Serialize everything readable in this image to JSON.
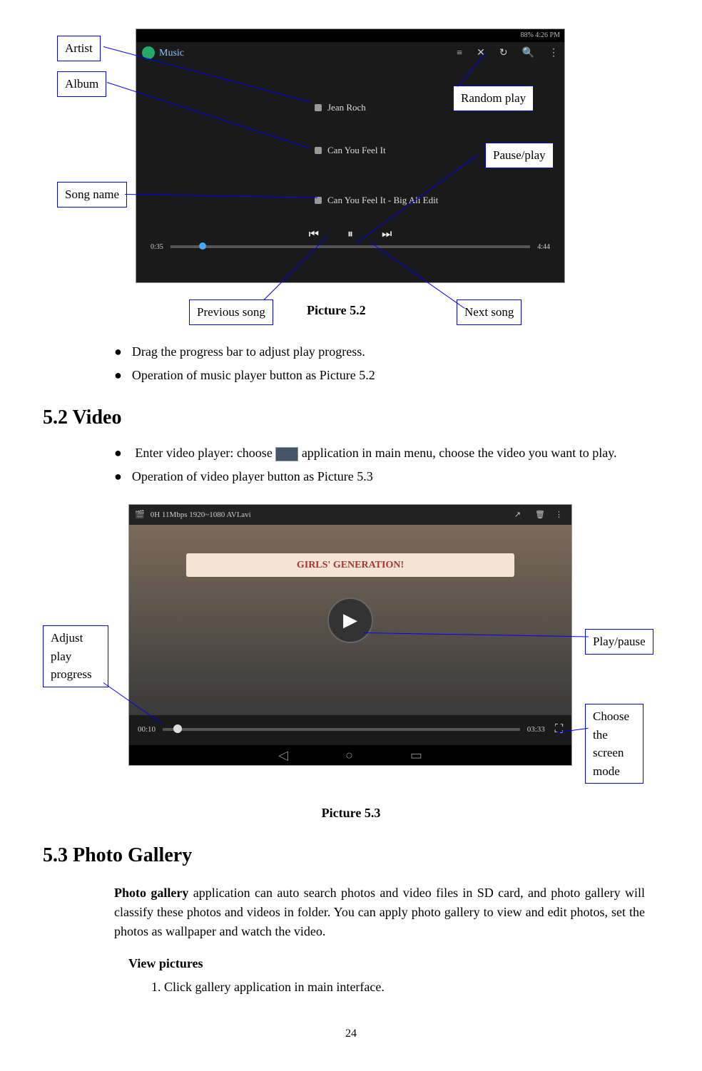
{
  "page_number": "24",
  "figure1": {
    "status": "88% 4:26 PM",
    "app_title": "Music",
    "artist": "Jean Roch",
    "album": "Can You Feel It",
    "song": "Can You Feel It - Big Ali Edit",
    "time_left": "0:35",
    "time_right": "4:44",
    "caption": "Picture 5.2",
    "callouts": {
      "artist": "Artist",
      "album": "Album",
      "song_name": "Song name",
      "random_play": "Random play",
      "pause_play": "Pause/play",
      "previous_song": "Previous song",
      "next_song": "Next song"
    }
  },
  "bullets1": {
    "b1": "Drag the progress bar to adjust play progress.",
    "b2": "Operation of music player button as Picture 5.2"
  },
  "heading_video": "5.2 Video",
  "bullets2": {
    "b1a": "Enter video player: choose ",
    "b1b": "application in main menu, choose the video you want to play.",
    "b2": "Operation of video player button as Picture 5.3"
  },
  "figure2": {
    "filename": "0H 11Mbps 1920~1080 AVI.avi",
    "banner": "GIRLS' GENERATION!",
    "time_left": "00:10",
    "time_right": "03:33",
    "caption": "Picture 5.3",
    "callouts": {
      "adjust": "Adjust play progress",
      "playpause": "Play/pause",
      "screenmode": "Choose the screen mode"
    }
  },
  "heading_gallery": "5.3 Photo Gallery",
  "gallery_para_lead": "Photo gallery",
  "gallery_para_rest": " application can auto search photos and video files in SD card, and photo gallery will classify these photos and videos in folder. You can apply photo gallery to view and edit photos, set the photos as wallpaper and watch the video.",
  "view_pictures": "View pictures",
  "step1": "Click gallery application in main interface."
}
